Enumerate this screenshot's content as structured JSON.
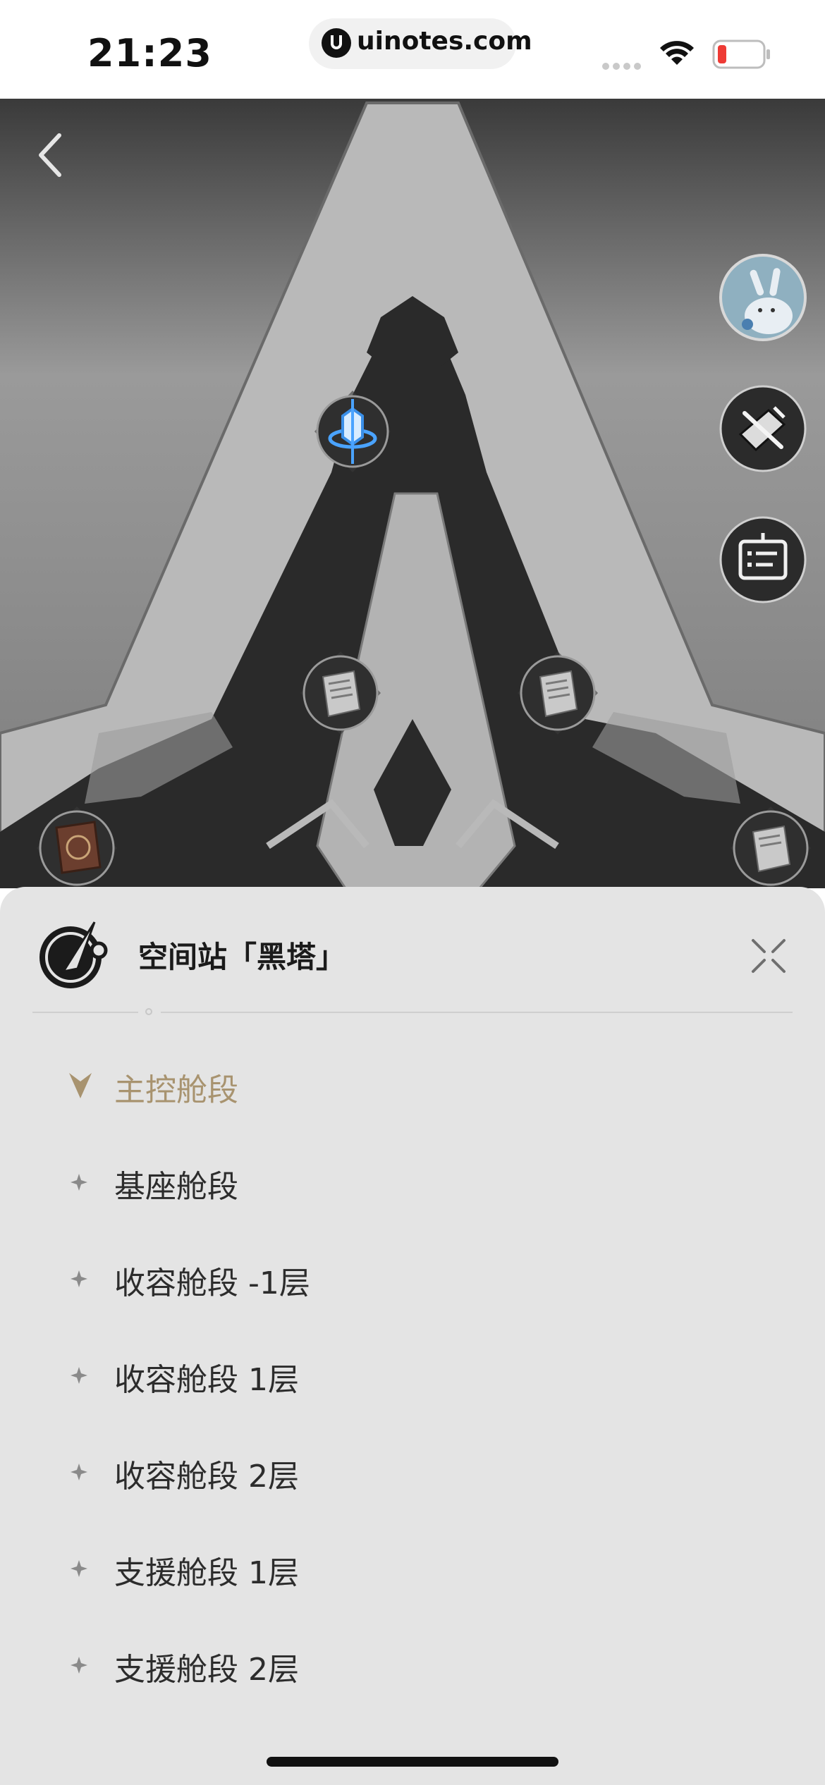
{
  "status_bar": {
    "time": "21:23",
    "url": "uinotes.com"
  },
  "map": {
    "back_icon": "chevron-left-icon",
    "side_buttons": [
      {
        "name": "avatar",
        "icon": "bunny-avatar-icon"
      },
      {
        "name": "archive-book",
        "icon": "book-sword-icon"
      },
      {
        "name": "notice-board",
        "icon": "notice-board-icon"
      }
    ],
    "markers": [
      {
        "name": "space-anchor-marker",
        "icon": "space-anchor-icon"
      },
      {
        "name": "document-marker-left",
        "icon": "document-icon"
      },
      {
        "name": "document-marker-right",
        "icon": "document-icon"
      },
      {
        "name": "tome-marker",
        "icon": "tome-icon"
      },
      {
        "name": "document-marker-edge",
        "icon": "document-icon"
      }
    ]
  },
  "sheet": {
    "title": "空间站「黑塔」",
    "emblem_icon": "compass-emblem-icon",
    "close_icon": "close-icon",
    "items": [
      {
        "label": "主控舱段",
        "active": true
      },
      {
        "label": "基座舱段",
        "active": false
      },
      {
        "label": "收容舱段 -1层",
        "active": false
      },
      {
        "label": "收容舱段 1层",
        "active": false
      },
      {
        "label": "收容舱段 2层",
        "active": false
      },
      {
        "label": "支援舱段 1层",
        "active": false
      },
      {
        "label": "支援舱段 2层",
        "active": false
      }
    ]
  },
  "colors": {
    "active_item": "#a8936f",
    "sheet_bg": "#e4e4e4",
    "map_bg": "#8a8a8a",
    "tower_dark": "#2a2a2a"
  }
}
